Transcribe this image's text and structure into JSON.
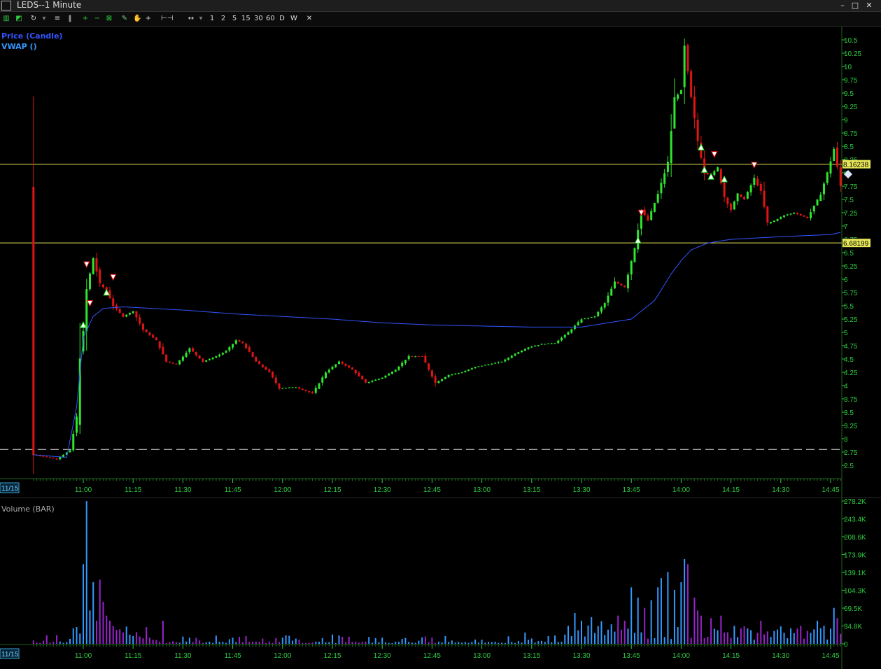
{
  "window": {
    "title": "LEDS--1 Minute",
    "buttons": [
      "–",
      "□",
      "✕"
    ]
  },
  "toolbar": {
    "tools": [
      "bar-chart-icon",
      "line-chart-icon",
      "refresh-icon",
      "chevron-down-icon",
      "equals-icon",
      "pause-icon",
      "zoom-in-icon",
      "zoom-out-icon",
      "fit-icon",
      "pencil-icon",
      "hand-icon",
      "crosshair-icon",
      "measure-icon",
      "pan-icon",
      "chevron-down-icon"
    ],
    "periods": [
      "1",
      "2",
      "5",
      "15",
      "30",
      "60",
      "D",
      "W",
      "✕"
    ]
  },
  "legend": {
    "price": "Price (Candle)",
    "vwap": "VWAP ()",
    "volume": "Volume (BAR)"
  },
  "colors": {
    "up": "#2ee62e",
    "down": "#e01414",
    "vwap": "#3355ff",
    "hline": "#e8e85a",
    "axis": "#2ecc40",
    "vol_blue": "#3399ff",
    "vol_purple": "#9922cc"
  },
  "chart_data": [
    {
      "type": "candlestick",
      "title": "LEDS--1 Minute",
      "date_label": "11/15",
      "x_tick_labels": [
        "11:00",
        "11:15",
        "11:30",
        "11:45",
        "12:00",
        "12:15",
        "12:30",
        "12:45",
        "13:00",
        "13:15",
        "13:30",
        "13:45",
        "14:00",
        "14:15",
        "14:30",
        "14:45"
      ],
      "y_tick_labels": [
        "10.5",
        "10.25",
        "10",
        "9.75",
        "9.5",
        "9.25",
        "9",
        "8.75",
        "8.5",
        "8.25",
        "8",
        "7.75",
        "7.5",
        "7.25",
        "7",
        "6.75",
        "6.5",
        "6.25",
        "6",
        "5.75",
        "5.5",
        "5.25",
        "5",
        "4.75",
        "4.5",
        "4.25",
        "4",
        "3.75",
        "3.5",
        "3.25",
        "3",
        "2.75",
        "2.5"
      ],
      "ylim": [
        2.25,
        10.65
      ],
      "x_range_minutes": [
        "10:45",
        "14:48"
      ],
      "price_path": [
        [
          "10:45",
          2.7
        ],
        [
          "10:52",
          2.62
        ],
        [
          "10:56",
          2.78
        ],
        [
          "10:58",
          3.4
        ],
        [
          "10:59",
          4.6
        ],
        [
          "11:00",
          5.0
        ],
        [
          "11:01",
          5.8
        ],
        [
          "11:03",
          6.4
        ],
        [
          "11:05",
          5.9
        ],
        [
          "11:07",
          5.8
        ],
        [
          "11:09",
          5.5
        ],
        [
          "11:12",
          5.3
        ],
        [
          "11:15",
          5.4
        ],
        [
          "11:18",
          5.05
        ],
        [
          "11:22",
          4.85
        ],
        [
          "11:25",
          4.45
        ],
        [
          "11:28",
          4.4
        ],
        [
          "11:32",
          4.7
        ],
        [
          "11:36",
          4.45
        ],
        [
          "11:40",
          4.55
        ],
        [
          "11:43",
          4.65
        ],
        [
          "11:46",
          4.85
        ],
        [
          "11:48",
          4.8
        ],
        [
          "11:52",
          4.45
        ],
        [
          "11:56",
          4.25
        ],
        [
          "11:59",
          3.95
        ],
        [
          "12:04",
          3.97
        ],
        [
          "12:09",
          3.85
        ],
        [
          "12:13",
          4.25
        ],
        [
          "12:17",
          4.45
        ],
        [
          "12:21",
          4.3
        ],
        [
          "12:25",
          4.05
        ],
        [
          "12:30",
          4.15
        ],
        [
          "12:34",
          4.3
        ],
        [
          "12:38",
          4.55
        ],
        [
          "12:42",
          4.55
        ],
        [
          "12:46",
          4.05
        ],
        [
          "12:50",
          4.2
        ],
        [
          "12:54",
          4.25
        ],
        [
          "12:58",
          4.35
        ],
        [
          "13:02",
          4.4
        ],
        [
          "13:06",
          4.45
        ],
        [
          "13:10",
          4.6
        ],
        [
          "13:14",
          4.72
        ],
        [
          "13:18",
          4.78
        ],
        [
          "13:22",
          4.8
        ],
        [
          "13:26",
          5.0
        ],
        [
          "13:30",
          5.25
        ],
        [
          "13:34",
          5.3
        ],
        [
          "13:37",
          5.55
        ],
        [
          "13:40",
          5.95
        ],
        [
          "13:43",
          5.85
        ],
        [
          "13:46",
          6.6
        ],
        [
          "13:48",
          7.3
        ],
        [
          "13:50",
          7.1
        ],
        [
          "13:53",
          7.6
        ],
        [
          "13:56",
          8.2
        ],
        [
          "13:58",
          9.4
        ],
        [
          "14:00",
          9.55
        ],
        [
          "14:01",
          10.35
        ],
        [
          "14:03",
          9.4
        ],
        [
          "14:05",
          8.6
        ],
        [
          "14:07",
          8.0
        ],
        [
          "14:09",
          7.95
        ],
        [
          "14:11",
          8.1
        ],
        [
          "14:13",
          7.55
        ],
        [
          "14:15",
          7.3
        ],
        [
          "14:17",
          7.6
        ],
        [
          "14:19",
          7.5
        ],
        [
          "14:22",
          7.9
        ],
        [
          "14:24",
          7.65
        ],
        [
          "14:26",
          7.05
        ],
        [
          "14:28",
          7.1
        ],
        [
          "14:31",
          7.2
        ],
        [
          "14:34",
          7.25
        ],
        [
          "14:38",
          7.15
        ],
        [
          "14:42",
          7.6
        ],
        [
          "14:44",
          8.0
        ],
        [
          "14:46",
          8.45
        ],
        [
          "14:48",
          7.75
        ]
      ],
      "vwap_path": [
        [
          "10:45",
          2.7
        ],
        [
          "10:55",
          2.65
        ],
        [
          "10:58",
          3.6
        ],
        [
          "11:00",
          4.9
        ],
        [
          "11:03",
          5.3
        ],
        [
          "11:06",
          5.45
        ],
        [
          "11:12",
          5.48
        ],
        [
          "11:30",
          5.42
        ],
        [
          "11:45",
          5.35
        ],
        [
          "12:00",
          5.3
        ],
        [
          "12:15",
          5.25
        ],
        [
          "12:30",
          5.18
        ],
        [
          "12:45",
          5.14
        ],
        [
          "13:00",
          5.12
        ],
        [
          "13:15",
          5.1
        ],
        [
          "13:30",
          5.1
        ],
        [
          "13:45",
          5.25
        ],
        [
          "13:52",
          5.6
        ],
        [
          "13:57",
          6.1
        ],
        [
          "14:00",
          6.35
        ],
        [
          "14:03",
          6.55
        ],
        [
          "14:08",
          6.68
        ],
        [
          "14:15",
          6.75
        ],
        [
          "14:30",
          6.8
        ],
        [
          "14:45",
          6.84
        ],
        [
          "14:48",
          6.88
        ]
      ],
      "horizontal_lines": [
        {
          "label": "8.16238",
          "value": 8.16238,
          "style": "solid"
        },
        {
          "label": "6.68199",
          "value": 6.68199,
          "style": "solid"
        },
        {
          "value": 2.8,
          "style": "dashed"
        }
      ],
      "buy_markers": [
        [
          "11:00",
          5.13
        ],
        [
          "11:07",
          5.74
        ],
        [
          "13:47",
          6.72
        ],
        [
          "14:06",
          8.47
        ],
        [
          "14:07",
          8.05
        ],
        [
          "14:09",
          7.92
        ],
        [
          "14:13",
          7.87
        ]
      ],
      "sell_markers": [
        [
          "11:01",
          6.29
        ],
        [
          "11:02",
          5.56
        ],
        [
          "11:09",
          6.05
        ],
        [
          "13:48",
          7.26
        ],
        [
          "14:10",
          8.36
        ],
        [
          "14:22",
          8.16
        ]
      ]
    },
    {
      "type": "bar",
      "title": "Volume (BAR)",
      "date_label": "11/15",
      "x_tick_labels": [
        "11:00",
        "11:15",
        "11:30",
        "11:45",
        "12:00",
        "12:15",
        "12:30",
        "12:45",
        "13:00",
        "13:15",
        "13:30",
        "13:45",
        "14:00",
        "14:15",
        "14:30",
        "14:45"
      ],
      "y_tick_labels": [
        "278.2K",
        "243.4K",
        "208.6K",
        "173.9K",
        "139.1K",
        "104.3K",
        "69.5K",
        "34.8K",
        "0"
      ],
      "ylim": [
        0,
        278200
      ],
      "x_range_minutes": [
        "10:45",
        "14:48"
      ],
      "peaks": [
        [
          "10:57",
          30000
        ],
        [
          "10:59",
          20000
        ],
        [
          "11:00",
          155000
        ],
        [
          "11:01",
          278000
        ],
        [
          "11:02",
          65000
        ],
        [
          "11:03",
          120000
        ],
        [
          "11:04",
          45000
        ],
        [
          "11:05",
          125000
        ],
        [
          "11:06",
          82000
        ],
        [
          "11:07",
          55000
        ],
        [
          "11:08",
          45000
        ],
        [
          "11:09",
          35000
        ],
        [
          "11:12",
          22000
        ],
        [
          "11:15",
          15000
        ],
        [
          "11:20",
          12000
        ],
        [
          "11:24",
          45000
        ],
        [
          "11:30",
          14000
        ],
        [
          "11:45",
          12000
        ],
        [
          "12:00",
          12000
        ],
        [
          "12:15",
          18000
        ],
        [
          "12:30",
          12000
        ],
        [
          "12:45",
          12000
        ],
        [
          "13:00",
          8000
        ],
        [
          "13:13",
          22000
        ],
        [
          "13:25",
          18000
        ],
        [
          "13:28",
          60000
        ],
        [
          "13:30",
          45000
        ],
        [
          "13:33",
          52000
        ],
        [
          "13:36",
          44000
        ],
        [
          "13:39",
          38000
        ],
        [
          "13:41",
          55000
        ],
        [
          "13:43",
          45000
        ],
        [
          "13:45",
          110000
        ],
        [
          "13:47",
          90000
        ],
        [
          "13:49",
          70000
        ],
        [
          "13:51",
          85000
        ],
        [
          "13:53",
          110000
        ],
        [
          "13:54",
          128000
        ],
        [
          "13:56",
          140000
        ],
        [
          "13:58",
          105000
        ],
        [
          "14:00",
          120000
        ],
        [
          "14:01",
          165000
        ],
        [
          "14:02",
          155000
        ],
        [
          "14:04",
          90000
        ],
        [
          "14:05",
          65000
        ],
        [
          "14:06",
          55000
        ],
        [
          "14:09",
          50000
        ],
        [
          "14:12",
          55000
        ],
        [
          "14:16",
          35000
        ],
        [
          "14:20",
          30000
        ],
        [
          "14:24",
          45000
        ],
        [
          "14:28",
          25000
        ],
        [
          "14:33",
          30000
        ],
        [
          "14:37",
          10000
        ],
        [
          "14:41",
          45000
        ],
        [
          "14:43",
          35000
        ],
        [
          "14:46",
          70000
        ],
        [
          "14:47",
          50000
        ]
      ]
    }
  ]
}
